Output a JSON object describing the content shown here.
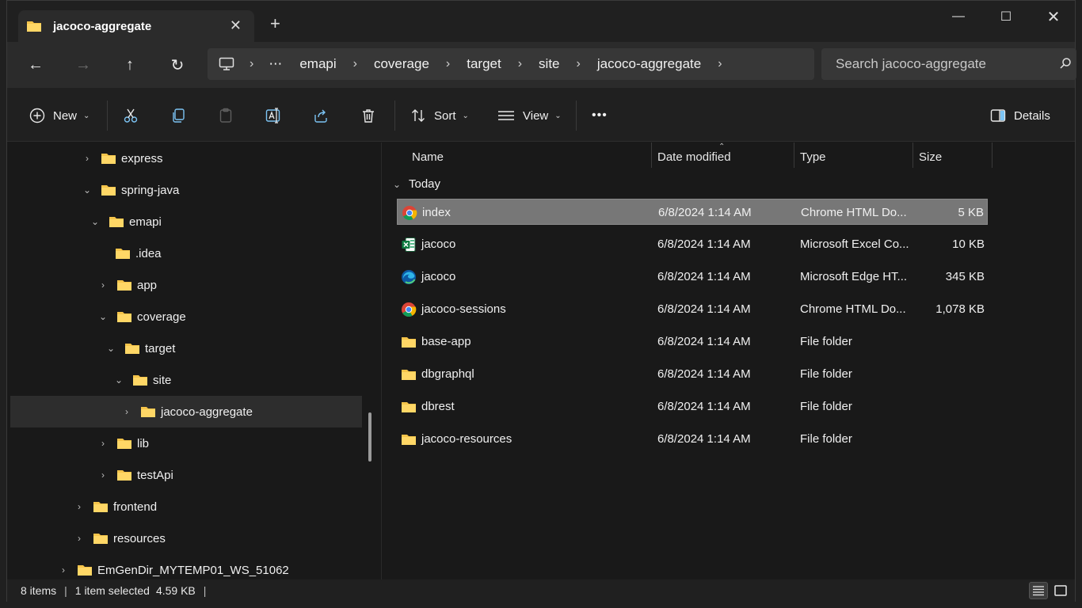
{
  "window": {
    "tab_title": "jacoco-aggregate",
    "tab_close_glyph": "✕",
    "new_tab_glyph": "+",
    "minimize_glyph": "—",
    "maximize_glyph": "☐",
    "close_glyph": "✕"
  },
  "nav": {
    "back_glyph": "←",
    "forward_glyph": "→",
    "up_glyph": "↑",
    "refresh_glyph": "↻",
    "more_glyph": "⋯",
    "breadcrumbs": [
      "emapi",
      "coverage",
      "target",
      "site",
      "jacoco-aggregate"
    ],
    "separator": "›",
    "search_placeholder": "Search jacoco-aggregate"
  },
  "toolbar": {
    "new_label": "New",
    "sort_label": "Sort",
    "view_label": "View",
    "more_glyph": "•••",
    "details_label": "Details",
    "chevron": "⌄"
  },
  "tree": {
    "collapsed_glyph": "›",
    "expanded_glyph": "⌄",
    "items": [
      {
        "label": "express"
      },
      {
        "label": "spring-java"
      },
      {
        "label": "emapi"
      },
      {
        "label": ".idea"
      },
      {
        "label": "app"
      },
      {
        "label": "coverage"
      },
      {
        "label": "target"
      },
      {
        "label": "site"
      },
      {
        "label": "jacoco-aggregate"
      },
      {
        "label": "lib"
      },
      {
        "label": "testApi"
      },
      {
        "label": "frontend"
      },
      {
        "label": "resources"
      },
      {
        "label": "EmGenDir_MYTEMP01_WS_51062"
      }
    ]
  },
  "content": {
    "columns": {
      "name": "Name",
      "date": "Date modified",
      "type": "Type",
      "size": "Size"
    },
    "sort_caret": "⌃",
    "group_label": "Today",
    "files": [
      {
        "icon": "chrome-icon",
        "name": "index",
        "date": "6/8/2024 1:14 AM",
        "type": "Chrome HTML Do...",
        "size": "5 KB"
      },
      {
        "icon": "excel-icon",
        "name": "jacoco",
        "date": "6/8/2024 1:14 AM",
        "type": "Microsoft Excel Co...",
        "size": "10 KB"
      },
      {
        "icon": "edge-icon",
        "name": "jacoco",
        "date": "6/8/2024 1:14 AM",
        "type": "Microsoft Edge HT...",
        "size": "345 KB"
      },
      {
        "icon": "chrome-icon",
        "name": "jacoco-sessions",
        "date": "6/8/2024 1:14 AM",
        "type": "Chrome HTML Do...",
        "size": "1,078 KB"
      },
      {
        "icon": "folder-icon",
        "name": "base-app",
        "date": "6/8/2024 1:14 AM",
        "type": "File folder",
        "size": ""
      },
      {
        "icon": "folder-icon",
        "name": "dbgraphql",
        "date": "6/8/2024 1:14 AM",
        "type": "File folder",
        "size": ""
      },
      {
        "icon": "folder-icon",
        "name": "dbrest",
        "date": "6/8/2024 1:14 AM",
        "type": "File folder",
        "size": ""
      },
      {
        "icon": "folder-icon",
        "name": "jacoco-resources",
        "date": "6/8/2024 1:14 AM",
        "type": "File folder",
        "size": ""
      }
    ]
  },
  "status": {
    "item_count": "8 items",
    "selection": "1 item selected",
    "selection_size": "4.59 KB",
    "bar": "|"
  },
  "colors": {
    "folder": "#f5c44a",
    "accent": "#4cc2ff",
    "selected_row": "#777777"
  }
}
